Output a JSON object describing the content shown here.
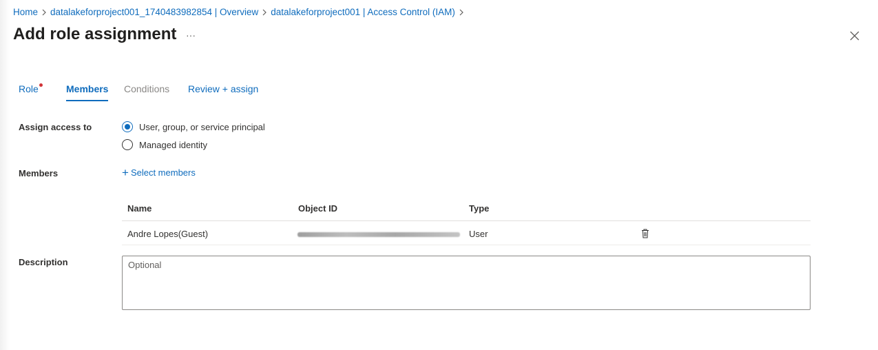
{
  "breadcrumb": [
    {
      "label": "Home"
    },
    {
      "label": "datalakeforproject001_1740483982854 | Overview"
    },
    {
      "label": "datalakeforproject001 | Access Control (IAM)"
    }
  ],
  "title": "Add role assignment",
  "more_label": "···",
  "tabs": [
    {
      "label": "Role",
      "required": true
    },
    {
      "label": "Members",
      "active": true
    },
    {
      "label": "Conditions",
      "disabled": true
    },
    {
      "label": "Review + assign"
    }
  ],
  "assign_access": {
    "label": "Assign access to",
    "options": [
      {
        "label": "User, group, or service principal",
        "checked": true
      },
      {
        "label": "Managed identity",
        "checked": false
      }
    ]
  },
  "members": {
    "label": "Members",
    "select_label": "Select members",
    "columns": [
      "Name",
      "Object ID",
      "Type"
    ],
    "rows": [
      {
        "name": "Andre Lopes(Guest)",
        "type": "User"
      }
    ]
  },
  "description": {
    "label": "Description",
    "placeholder": "Optional"
  },
  "colors": {
    "accent": "#0f6cbd",
    "required": "#d13438"
  }
}
